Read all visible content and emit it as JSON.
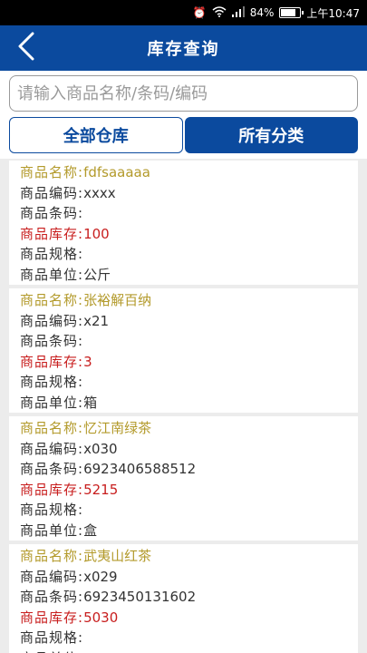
{
  "status": {
    "battery": "84%",
    "time": "上午10:47",
    "battery_level": 0.84
  },
  "nav": {
    "title": "库存查询"
  },
  "search": {
    "placeholder": "请输入商品名称/条码/编码"
  },
  "filters": {
    "warehouse": "全部仓库",
    "category": "所有分类"
  },
  "labels": {
    "name": "商品名称:",
    "code": "商品编码:",
    "barcode": "商品条码:",
    "stock": "商品库存:",
    "spec": "商品规格:",
    "unit": "商品单位:"
  },
  "colors": {
    "primary": "#0b4a9e",
    "name_color": "#b39a2b",
    "stock_color": "#c81e1e"
  },
  "products": [
    {
      "name": "fdfsaaaaa",
      "code": "xxxx",
      "barcode": "",
      "stock": "100",
      "spec": "",
      "unit": "公斤"
    },
    {
      "name": "张裕解百纳",
      "code": "x21",
      "barcode": "",
      "stock": "3",
      "spec": "",
      "unit": "箱"
    },
    {
      "name": "忆江南绿茶",
      "code": "x030",
      "barcode": "6923406588512",
      "stock": "5215",
      "spec": "",
      "unit": "盒"
    },
    {
      "name": "武夷山红茶",
      "code": "x029",
      "barcode": "6923450131602",
      "stock": "5030",
      "spec": "",
      "unit": ""
    }
  ]
}
